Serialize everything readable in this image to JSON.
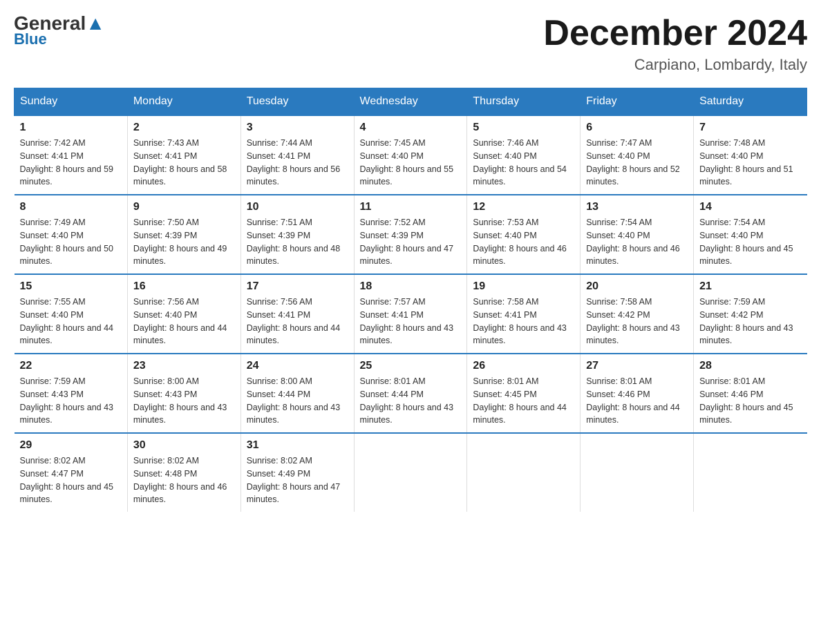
{
  "header": {
    "logo_general": "General",
    "logo_triangle": "",
    "logo_blue": "Blue",
    "month_title": "December 2024",
    "location": "Carpiano, Lombardy, Italy"
  },
  "weekdays": [
    "Sunday",
    "Monday",
    "Tuesday",
    "Wednesday",
    "Thursday",
    "Friday",
    "Saturday"
  ],
  "weeks": [
    [
      {
        "day": "1",
        "sunrise": "7:42 AM",
        "sunset": "4:41 PM",
        "daylight": "8 hours and 59 minutes."
      },
      {
        "day": "2",
        "sunrise": "7:43 AM",
        "sunset": "4:41 PM",
        "daylight": "8 hours and 58 minutes."
      },
      {
        "day": "3",
        "sunrise": "7:44 AM",
        "sunset": "4:41 PM",
        "daylight": "8 hours and 56 minutes."
      },
      {
        "day": "4",
        "sunrise": "7:45 AM",
        "sunset": "4:40 PM",
        "daylight": "8 hours and 55 minutes."
      },
      {
        "day": "5",
        "sunrise": "7:46 AM",
        "sunset": "4:40 PM",
        "daylight": "8 hours and 54 minutes."
      },
      {
        "day": "6",
        "sunrise": "7:47 AM",
        "sunset": "4:40 PM",
        "daylight": "8 hours and 52 minutes."
      },
      {
        "day": "7",
        "sunrise": "7:48 AM",
        "sunset": "4:40 PM",
        "daylight": "8 hours and 51 minutes."
      }
    ],
    [
      {
        "day": "8",
        "sunrise": "7:49 AM",
        "sunset": "4:40 PM",
        "daylight": "8 hours and 50 minutes."
      },
      {
        "day": "9",
        "sunrise": "7:50 AM",
        "sunset": "4:39 PM",
        "daylight": "8 hours and 49 minutes."
      },
      {
        "day": "10",
        "sunrise": "7:51 AM",
        "sunset": "4:39 PM",
        "daylight": "8 hours and 48 minutes."
      },
      {
        "day": "11",
        "sunrise": "7:52 AM",
        "sunset": "4:39 PM",
        "daylight": "8 hours and 47 minutes."
      },
      {
        "day": "12",
        "sunrise": "7:53 AM",
        "sunset": "4:40 PM",
        "daylight": "8 hours and 46 minutes."
      },
      {
        "day": "13",
        "sunrise": "7:54 AM",
        "sunset": "4:40 PM",
        "daylight": "8 hours and 46 minutes."
      },
      {
        "day": "14",
        "sunrise": "7:54 AM",
        "sunset": "4:40 PM",
        "daylight": "8 hours and 45 minutes."
      }
    ],
    [
      {
        "day": "15",
        "sunrise": "7:55 AM",
        "sunset": "4:40 PM",
        "daylight": "8 hours and 44 minutes."
      },
      {
        "day": "16",
        "sunrise": "7:56 AM",
        "sunset": "4:40 PM",
        "daylight": "8 hours and 44 minutes."
      },
      {
        "day": "17",
        "sunrise": "7:56 AM",
        "sunset": "4:41 PM",
        "daylight": "8 hours and 44 minutes."
      },
      {
        "day": "18",
        "sunrise": "7:57 AM",
        "sunset": "4:41 PM",
        "daylight": "8 hours and 43 minutes."
      },
      {
        "day": "19",
        "sunrise": "7:58 AM",
        "sunset": "4:41 PM",
        "daylight": "8 hours and 43 minutes."
      },
      {
        "day": "20",
        "sunrise": "7:58 AM",
        "sunset": "4:42 PM",
        "daylight": "8 hours and 43 minutes."
      },
      {
        "day": "21",
        "sunrise": "7:59 AM",
        "sunset": "4:42 PM",
        "daylight": "8 hours and 43 minutes."
      }
    ],
    [
      {
        "day": "22",
        "sunrise": "7:59 AM",
        "sunset": "4:43 PM",
        "daylight": "8 hours and 43 minutes."
      },
      {
        "day": "23",
        "sunrise": "8:00 AM",
        "sunset": "4:43 PM",
        "daylight": "8 hours and 43 minutes."
      },
      {
        "day": "24",
        "sunrise": "8:00 AM",
        "sunset": "4:44 PM",
        "daylight": "8 hours and 43 minutes."
      },
      {
        "day": "25",
        "sunrise": "8:01 AM",
        "sunset": "4:44 PM",
        "daylight": "8 hours and 43 minutes."
      },
      {
        "day": "26",
        "sunrise": "8:01 AM",
        "sunset": "4:45 PM",
        "daylight": "8 hours and 44 minutes."
      },
      {
        "day": "27",
        "sunrise": "8:01 AM",
        "sunset": "4:46 PM",
        "daylight": "8 hours and 44 minutes."
      },
      {
        "day": "28",
        "sunrise": "8:01 AM",
        "sunset": "4:46 PM",
        "daylight": "8 hours and 45 minutes."
      }
    ],
    [
      {
        "day": "29",
        "sunrise": "8:02 AM",
        "sunset": "4:47 PM",
        "daylight": "8 hours and 45 minutes."
      },
      {
        "day": "30",
        "sunrise": "8:02 AM",
        "sunset": "4:48 PM",
        "daylight": "8 hours and 46 minutes."
      },
      {
        "day": "31",
        "sunrise": "8:02 AM",
        "sunset": "4:49 PM",
        "daylight": "8 hours and 47 minutes."
      },
      null,
      null,
      null,
      null
    ]
  ]
}
